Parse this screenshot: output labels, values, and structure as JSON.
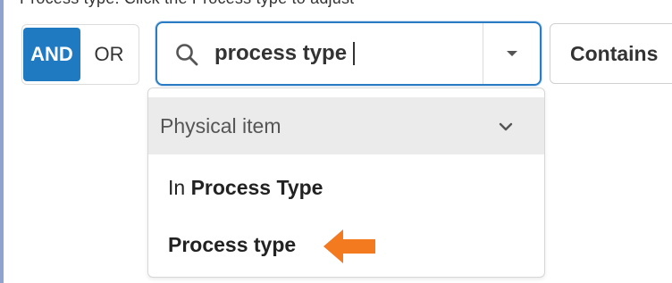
{
  "top_text": "Process type: Click the Process type to adjust",
  "logic_toggle": {
    "and_label": "AND",
    "or_label": "OR",
    "selected": "AND"
  },
  "search": {
    "value": "process type",
    "icon": "search-icon"
  },
  "operator": {
    "label": "Contains"
  },
  "menu": {
    "group_label": "Physical item",
    "items": [
      {
        "prefix": "In ",
        "label": "Process Type"
      },
      {
        "prefix": "",
        "label": "Process type"
      }
    ]
  },
  "colors": {
    "accent": "#1f7ac1",
    "focus_border": "#2b7cc2",
    "arrow": "#f47a20",
    "group_bg": "#ebebeb"
  }
}
